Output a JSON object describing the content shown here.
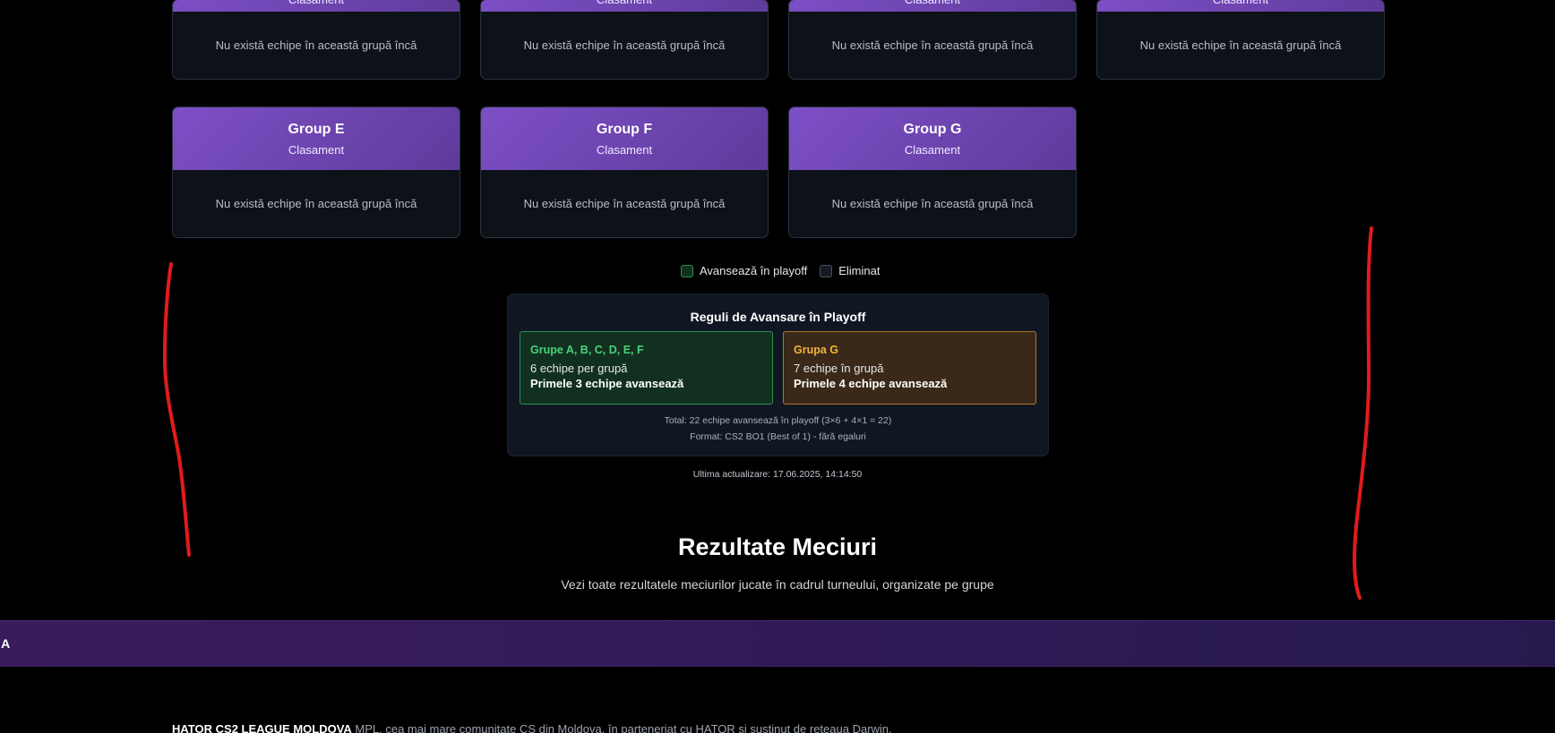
{
  "top_cards": [
    {
      "subtitle": "Clasament",
      "empty": "Nu există echipe în această grupă încă"
    },
    {
      "subtitle": "Clasament",
      "empty": "Nu există echipe în această grupă încă"
    },
    {
      "subtitle": "Clasament",
      "empty": "Nu există echipe în această grupă încă"
    },
    {
      "subtitle": "Clasament",
      "empty": "Nu există echipe în această grupă încă"
    }
  ],
  "cards": [
    {
      "title": "Group E",
      "subtitle": "Clasament",
      "empty": "Nu există echipe în această grupă încă"
    },
    {
      "title": "Group F",
      "subtitle": "Clasament",
      "empty": "Nu există echipe în această grupă încă"
    },
    {
      "title": "Group G",
      "subtitle": "Clasament",
      "empty": "Nu există echipe în această grupă încă"
    }
  ],
  "legend": {
    "advance": "Avansează în playoff",
    "eliminated": "Eliminat"
  },
  "rules": {
    "title": "Reguli de Avansare în Playoff",
    "green": {
      "title": "Grupe A, B, C, D, E, F",
      "line": "6 echipe per grupă",
      "strong": "Primele 3 echipe avansează"
    },
    "amber": {
      "title": "Grupa G",
      "line": "7 echipe în grupă",
      "strong": "Primele 4 echipe avansează"
    },
    "total": "Total: 22 echipe avansează în playoff (3×6 + 4×1 = 22)",
    "format": "Format: CS2 BO1 (Best of 1) - fără egaluri"
  },
  "updated": "Ultima actualizare: 17.06.2025, 14:14:50",
  "section": {
    "title": "Rezultate Meciuri",
    "subtitle": "Vezi toate rezultatele meciurilor jucate în cadrul turneului, organizate pe grupe"
  },
  "group_bar_label": "a A",
  "footer": {
    "brand": "HATOR CS2 LEAGUE MOLDOVA",
    "text": " MPL, cea mai mare comunitate CS din Moldova, în parteneriat cu HATOR și susținut de rețeaua Darwin."
  },
  "colors": {
    "accent": "#7d4fc6",
    "advance": "#2f8f4e",
    "group_g": "#f4b23c",
    "annotation": "#e21b1b"
  }
}
